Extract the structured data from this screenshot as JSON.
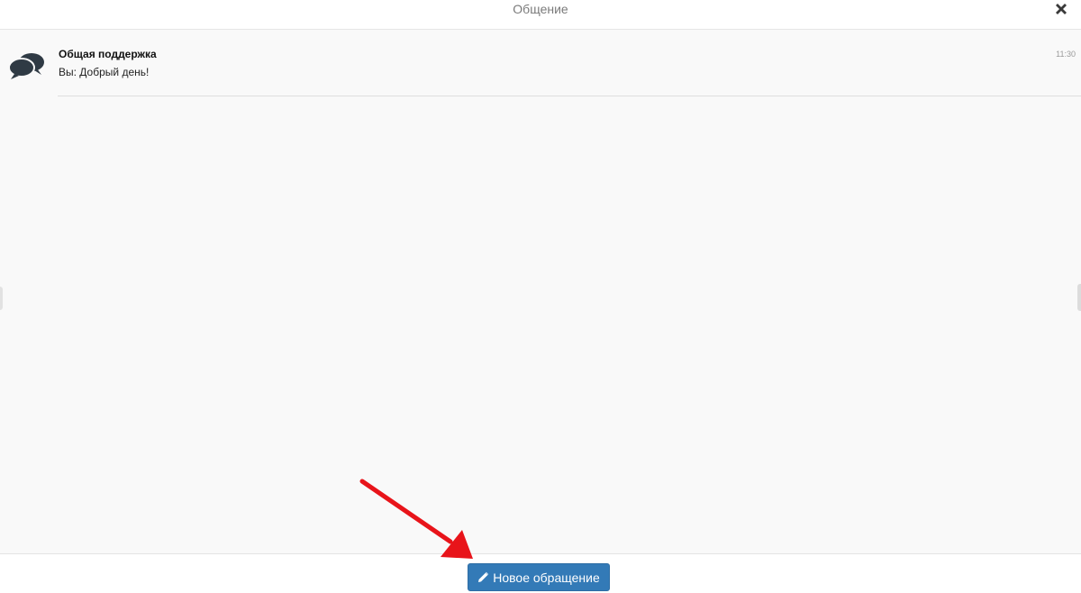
{
  "header": {
    "title": "Общение",
    "close_icon": "close-icon"
  },
  "conversations": [
    {
      "icon": "chat-bubbles-icon",
      "title": "Общая поддержка",
      "preview": "Вы: Добрый день!",
      "time": "11:30"
    }
  ],
  "footer": {
    "new_request_label": "Новое обращение",
    "new_request_icon": "pencil-icon"
  },
  "annotation": {
    "icon": "red-arrow-icon",
    "color": "#e8141a"
  },
  "colors": {
    "accent": "#337ab7",
    "background": "#f9f9f9"
  }
}
